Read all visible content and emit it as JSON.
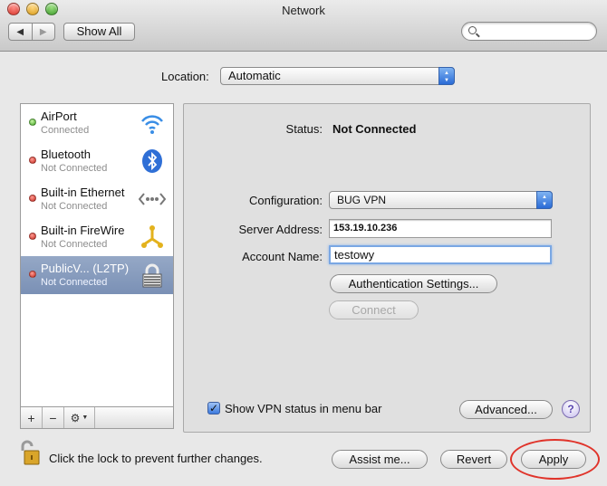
{
  "window": {
    "title": "Network"
  },
  "toolbar": {
    "back_icon": "back-arrow-icon",
    "forward_icon": "forward-arrow-icon",
    "show_all_label": "Show All",
    "search_placeholder": ""
  },
  "location": {
    "label": "Location:",
    "value": "Automatic"
  },
  "services": [
    {
      "name": "AirPort",
      "status": "Connected",
      "status_color": "#3ba11f",
      "icon": "wifi-icon"
    },
    {
      "name": "Bluetooth",
      "status": "Not Connected",
      "status_color": "#c4271c",
      "icon": "bluetooth-icon"
    },
    {
      "name": "Built-in Ethernet",
      "status": "Not Connected",
      "status_color": "#c4271c",
      "icon": "ethernet-icon"
    },
    {
      "name": "Built-in FireWire",
      "status": "Not Connected",
      "status_color": "#c4271c",
      "icon": "firewire-icon"
    },
    {
      "name": "PublicV... (L2TP)",
      "status": "Not Connected",
      "status_color": "#c4271c",
      "icon": "vpn-lock-icon",
      "selected": true
    }
  ],
  "sidebar_controls": {
    "add": "+",
    "remove": "−",
    "gear": "⚙"
  },
  "detail": {
    "status_label": "Status:",
    "status_value": "Not Connected",
    "configuration_label": "Configuration:",
    "configuration_value": "BUG VPN",
    "server_label": "Server Address:",
    "server_value": "153.19.10.236",
    "account_label": "Account Name:",
    "account_value": "testowy",
    "auth_button": "Authentication Settings...",
    "connect_button": "Connect",
    "show_vpn_label": "Show VPN status in menu bar",
    "show_vpn_checked": true,
    "advanced_button": "Advanced...",
    "help_button": "?"
  },
  "footer": {
    "lock_text": "Click the lock to prevent further changes.",
    "assist_button": "Assist me...",
    "revert_button": "Revert",
    "apply_button": "Apply"
  },
  "colors": {
    "selection": "#8a9ec0",
    "annotation_ring": "#e0342b",
    "focus": "#7aa7e3"
  }
}
